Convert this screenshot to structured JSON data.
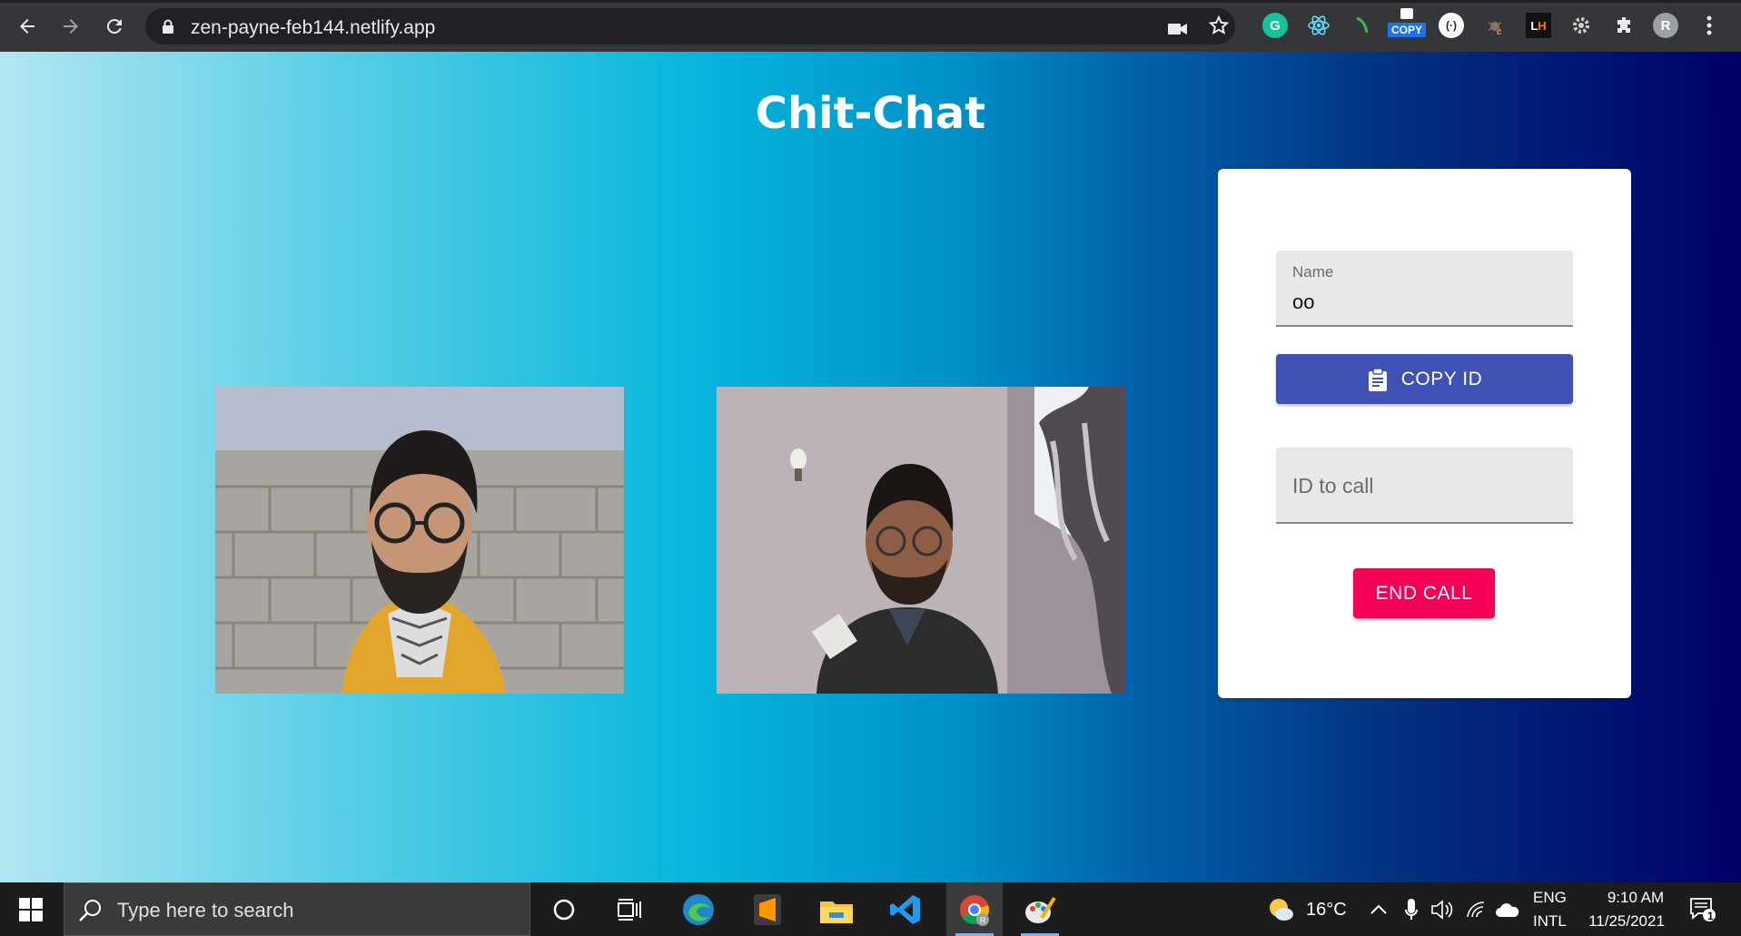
{
  "browser": {
    "url": "zen-payne-feb144.netlify.app",
    "profile_initial": "R",
    "copy_extension_label": "COPY"
  },
  "app": {
    "title": "Chit-Chat",
    "name_field": {
      "label": "Name",
      "value": "oo"
    },
    "copy_id_button": "COPY ID",
    "id_field": {
      "placeholder": "ID to call"
    },
    "end_call_button": "END CALL"
  },
  "colors": {
    "primary_button": "#3f51b5",
    "end_call_button": "#f50057"
  },
  "taskbar": {
    "search_placeholder": "Type here to search",
    "weather": "16°C",
    "language_top": "ENG",
    "language_bottom": "INTL",
    "time": "9:10 AM",
    "date": "11/25/2021",
    "notification_count": "1"
  }
}
